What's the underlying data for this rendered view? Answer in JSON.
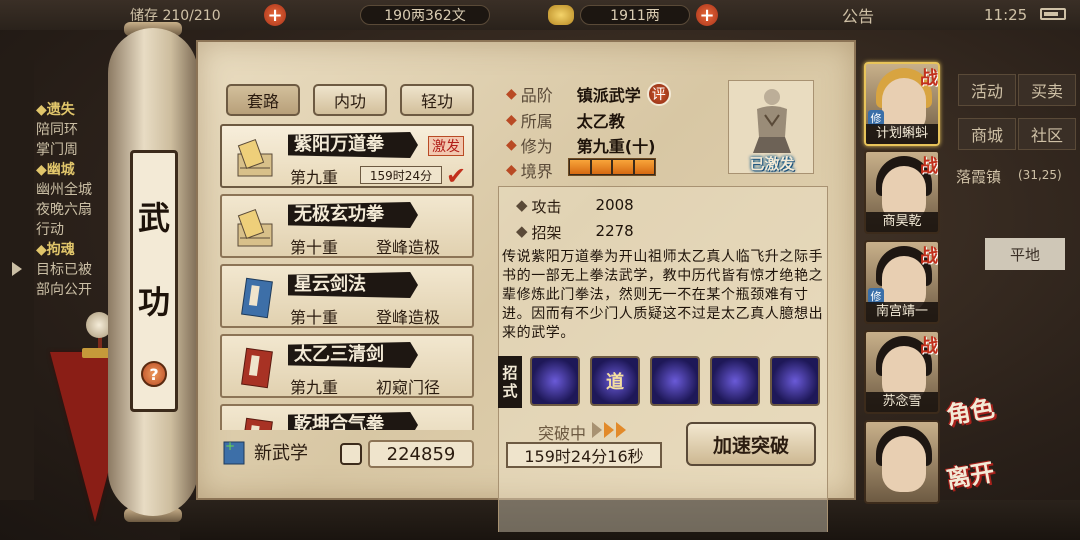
{
  "topbar": {
    "storage": "储存 210/210",
    "silver": "190两362文",
    "gold": "1911两",
    "notice": "公告",
    "time": "11:25"
  },
  "left_info": {
    "lines": [
      "◆遗失",
      "陪同环",
      "掌门周",
      "◆幽城",
      "幽州全城",
      "夜晚六扇",
      "行动",
      "◆拘魂",
      "目标已被",
      "部向公开"
    ]
  },
  "right_menu": {
    "activity": "活动",
    "trade": "买卖",
    "shop": "商城",
    "community": "社区",
    "location": "落霞镇",
    "coords": "(31,25)",
    "terrain": "平地"
  },
  "scroll": {
    "title_1": "武",
    "title_2": "功",
    "help": "?"
  },
  "tabs": [
    "套路",
    "内功",
    "轻功"
  ],
  "skills": [
    {
      "name": "紫阳万道拳",
      "level": "第九重",
      "status": "",
      "badge": "激发",
      "timer": "159时24分",
      "checked": true
    },
    {
      "name": "无极玄功拳",
      "level": "第十重",
      "status": "登峰造极"
    },
    {
      "name": "星云剑法",
      "level": "第十重",
      "status": "登峰造极"
    },
    {
      "name": "太乙三清剑",
      "level": "第九重",
      "status": "初窥门径"
    },
    {
      "name": "乾坤合气拳",
      "level": "",
      "status": ""
    }
  ],
  "bottom_left": {
    "new_skill": "新武学",
    "scroll_count": "224859"
  },
  "info": {
    "grade_key": "品阶",
    "grade_value": "镇派武学",
    "eval": "评",
    "belong_key": "所属",
    "belong_value": "太乙教",
    "cultivation_key": "修为",
    "cultivation_value": "第九重(十)",
    "realm_key": "境界",
    "realm_level": 4,
    "activated": "已激发"
  },
  "stats": {
    "attack_key": "攻击",
    "attack_value": "2008",
    "parry_key": "招架",
    "parry_value": "2278"
  },
  "description": "传说紫阳万道拳为开山祖师太乙真人临飞升之际手书的一部无上拳法武学，教中历代皆有惊才绝艳之辈修炼此门拳法，然则无一不在某个瓶颈难有寸进。因而有不少门人质疑这不过是太乙真人臆想出来的武学。",
  "moves": {
    "label_1": "招",
    "label_2": "式",
    "icon_texts": [
      "",
      "道",
      "",
      "",
      ""
    ]
  },
  "breakthrough": {
    "label": "突破中",
    "timer": "159时24分16秒",
    "speed_button": "加速突破"
  },
  "characters": [
    {
      "name": "计划蝌蚪",
      "zhan": "战",
      "xiu": "修"
    },
    {
      "name": "商昊乾",
      "zhan": "战",
      "xiu": ""
    },
    {
      "name": "南宫靖一",
      "zhan": "战",
      "xiu": "修"
    },
    {
      "name": "苏念雪",
      "zhan": "战",
      "xiu": ""
    },
    {
      "name": "",
      "zhan": "",
      "xiu": ""
    }
  ],
  "side_tags": {
    "role": "角色",
    "leave": "离开"
  }
}
